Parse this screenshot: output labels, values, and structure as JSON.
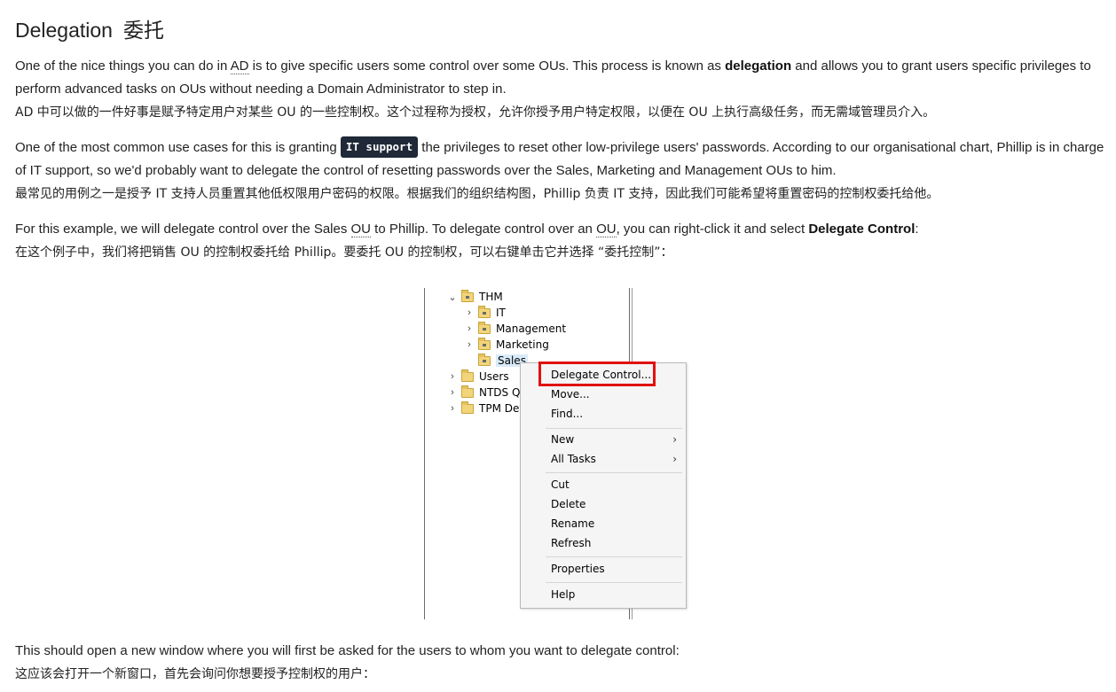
{
  "heading": {
    "en": "Delegation",
    "zh": "委托"
  },
  "p1": {
    "a": "One of the nice things you can do in ",
    "ad": "AD",
    "b": " is to give specific users some control over some OUs. This process is known as ",
    "bold": "delegation",
    "c": " and allows you to grant users specific privileges to",
    "line2": "perform advanced tasks on OUs without needing a Domain Administrator to step in.",
    "zh": "AD 中可以做的一件好事是赋予特定用户对某些 OU 的一些控制权。这个过程称为授权，允许你授予用户特定权限，以便在 OU 上执行高级任务，而无需域管理员介入。"
  },
  "p2": {
    "a": "One of the most common use cases for this is granting ",
    "code": "IT support",
    "b": " the privileges to reset other low-privilege users' passwords. According to our organisational chart, Phillip is in charge",
    "line2": "of IT support, so we'd probably want to delegate the control of resetting passwords over the Sales, Marketing and Management OUs to him.",
    "zh": "最常见的用例之一是授予 IT 支持人员重置其他低权限用户密码的权限。根据我们的组织结构图，Phillip 负责 IT 支持，因此我们可能希望将重置密码的控制权委托给他。"
  },
  "p3": {
    "a": "For this example, we will delegate control over the Sales ",
    "ou1": "OU",
    "b": " to Phillip. To delegate control over an ",
    "ou2": "OU",
    "c": ", you can right-click it and select ",
    "bold": "Delegate Control",
    "d": ":",
    "zh": "在这个例子中，我们将把销售 OU 的控制权委托给 Phillip。要委托 OU 的控制权，可以右键单击它并选择 “委托控制”："
  },
  "figure": {
    "tree": {
      "thm": "THM",
      "it": "IT",
      "management": "Management",
      "marketing": "Marketing",
      "sales": "Sales",
      "users": "Users",
      "ntds": "NTDS Qu",
      "tpm": "TPM Dev"
    },
    "menu": {
      "delegate": "Delegate Control...",
      "move": "Move...",
      "find": "Find...",
      "new": "New",
      "all_tasks": "All Tasks",
      "cut": "Cut",
      "delete": "Delete",
      "rename": "Rename",
      "refresh": "Refresh",
      "properties": "Properties",
      "help": "Help",
      "arrow": "›"
    },
    "highlight_color": "#e0120f"
  },
  "p4": {
    "en": "This should open a new window where you will first be asked for the users to whom you want to delegate control:",
    "zh": "这应该会打开一个新窗口，首先会询问你想要授予控制权的用户："
  }
}
